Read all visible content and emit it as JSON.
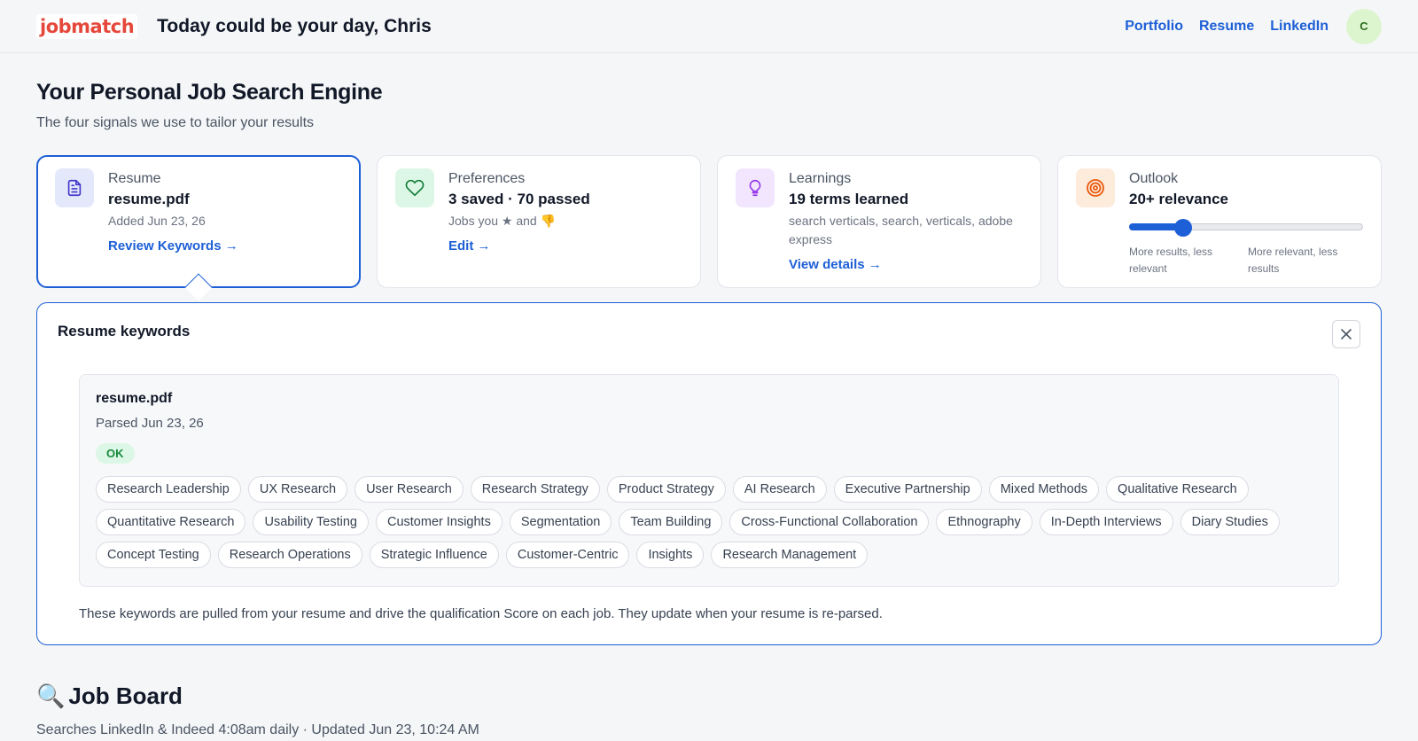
{
  "header": {
    "logo": "jobmatch",
    "greeting": "Today could be your day, Chris",
    "nav": [
      "Portfolio",
      "Resume",
      "LinkedIn"
    ],
    "avatar_initial": "C"
  },
  "page": {
    "title": "Your Personal Job Search Engine",
    "subtitle": "The four signals we use to tailor your results"
  },
  "cards": {
    "resume": {
      "title": "Resume",
      "value": "resume.pdf",
      "meta": "Added Jun 23, 26",
      "link": "Review Keywords →",
      "icon": "document-icon"
    },
    "preferences": {
      "title": "Preferences",
      "value": "3 saved · 70 passed",
      "meta": "Jobs you ★ and 👎",
      "link": "Edit →",
      "icon": "heart-icon"
    },
    "learnings": {
      "title": "Learnings",
      "value": "19 terms learned",
      "meta": "search verticals, search, verticals, adobe express",
      "link": "View details →",
      "icon": "lightbulb-icon"
    },
    "outlook": {
      "title": "Outlook",
      "value": "20+ relevance",
      "slider_level": 0.23,
      "label_left": "More results, less relevant",
      "label_right": "More relevant, less results",
      "icon": "target-icon"
    }
  },
  "keywords_panel": {
    "title": "Resume keywords",
    "file_name": "resume.pdf",
    "parsed": "Parsed Jun 23, 26",
    "status": "OK",
    "keywords": [
      "Research Leadership",
      "UX Research",
      "User Research",
      "Research Strategy",
      "Product Strategy",
      "AI Research",
      "Executive Partnership",
      "Mixed Methods",
      "Qualitative Research",
      "Quantitative Research",
      "Usability Testing",
      "Customer Insights",
      "Segmentation",
      "Team Building",
      "Cross-Functional Collaboration",
      "Ethnography",
      "In-Depth Interviews",
      "Diary Studies",
      "Concept Testing",
      "Research Operations",
      "Strategic Influence",
      "Customer-Centric",
      "Insights",
      "Research Management"
    ],
    "note": "These keywords are pulled from your resume and drive the qualification Score on each job. They update when your resume is re-parsed."
  },
  "job_board": {
    "icon": "🔍",
    "title": "Job Board",
    "subtitle": "Searches LinkedIn & Indeed 4:08am daily · Updated Jun 23, 10:24 AM"
  },
  "colors": {
    "accent": "#1d5fd6",
    "brand": "#e5483b",
    "ok": "#178a3c"
  }
}
